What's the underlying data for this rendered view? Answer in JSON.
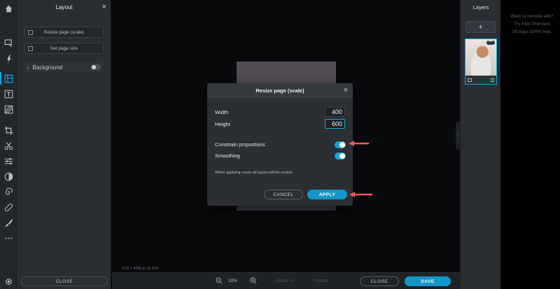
{
  "tool_rail": {
    "icons": [
      "home-icon",
      "arrange-icon",
      "magic-icon",
      "layout-icon",
      "text-icon",
      "pattern-icon",
      "crop-icon",
      "cut-icon",
      "adjust-icon",
      "contrast-icon",
      "swirl-icon",
      "bandage-icon",
      "brush-icon",
      "more-icon",
      "settings-icon"
    ],
    "active": "layout-icon"
  },
  "layout_panel": {
    "title": "Layout",
    "close_glyph": "×",
    "resize_scale_label": "Resize page (scale)",
    "set_size_label": "Set page size",
    "background_label": "Background",
    "close_button": "CLOSE"
  },
  "canvas": {
    "info": "2731 × 4096 px @ 10%"
  },
  "bottom_bar": {
    "zoom": "10%",
    "undo": "UNDO",
    "redo": "REDO",
    "close": "CLOSE",
    "save": "SAVE"
  },
  "layers_panel": {
    "title": "Layers",
    "add_glyph": "+",
    "menu_glyph": "•••"
  },
  "ad": {
    "lines": [
      "Want to remove ads?",
      "Try Pixlr Premium",
      "30 days 100% free."
    ]
  },
  "dialog": {
    "title": "Resize page (scale)",
    "close_glyph": "×",
    "width_label": "Width",
    "width_value": "400",
    "height_label": "Height",
    "height_value": "600",
    "constrain_label": "Constrain proportions",
    "constrain_on": true,
    "smoothing_label": "Smoothing",
    "smoothing_on": true,
    "hint": "When applying resize all layers will be scaled.",
    "cancel": "CANCEL",
    "apply": "APPLY"
  },
  "colors": {
    "accent": "#1496c8",
    "annotation_arrow": "#f0585a",
    "panel": "#2a2e33",
    "canvas": "#0d0e10"
  }
}
